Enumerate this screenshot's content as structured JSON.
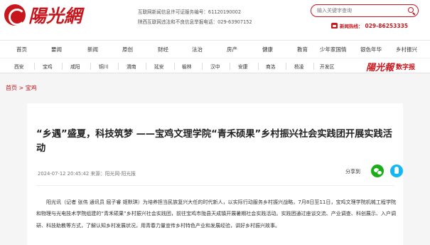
{
  "header": {
    "logo_text": "陽光網",
    "license_line1": "互联网新闻信息许可证服务编号：61120190002",
    "license_line2": "陕西互联网违法和不良信息举报电话：029-63907152",
    "search_placeholder": "输入关键字查询",
    "hotline_label": "新闻热线：",
    "hotline_number": "029-86253335"
  },
  "nav_main": [
    "首页",
    "要闻",
    "新闻",
    "原创",
    "财经",
    "法治",
    "房产",
    "健康",
    "教育",
    "少年家国情",
    "银色年华",
    "乡村振兴"
  ],
  "nav_cities": [
    "西安",
    "宝鸡",
    "咸阳",
    "铜川",
    "渭南",
    "延安",
    "榆林",
    "汉中",
    "安康",
    "商洛",
    "杨凌",
    "开发区"
  ],
  "paper": {
    "logo_text": "陽光報",
    "tag": "数字报"
  },
  "breadcrumb": {
    "home": "首页",
    "sep": " > ",
    "current": "宝鸡"
  },
  "article": {
    "title": "“乡遇”盛夏，科技筑梦 ——宝鸡文理学院“青禾硕果”乡村振兴社会实践团开展实践活动",
    "meta": "2024-07-12 20:45:42 来源：阳光网-阳光报",
    "share_label": "分享到",
    "body": "阳光讯（记者 张伟 通讯员 屈子睿 姬默琪）为培养担当民族复兴大任的时代新人，以实际行动服务乡村振兴战略，7月8日至11日，宝鸡文理学院机械工程学院和物理与光电技术学院组建的“青禾硕果”乡村振兴社会实践团，前往宝鸡市陇县天成镇开展暑期社会实践活动。实践团通过座谈交流、产业调查、科创展示、入户调研、科技助教等方式，了解认知乡村发展状况，用青春力量宣传乡村特色产业和发展经验，讲好乡村振兴故事。"
  },
  "colors": {
    "brand": "#c8161d",
    "wechat": "#1aad19",
    "qq": "#12b7f5"
  }
}
